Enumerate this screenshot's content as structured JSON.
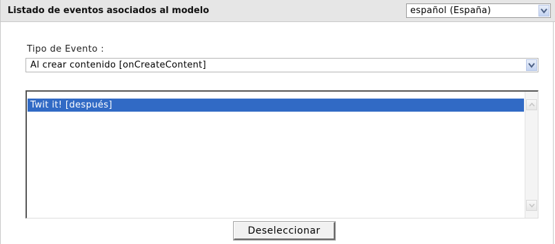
{
  "header": {
    "title": "Listado de eventos asociados al modelo",
    "language_select": {
      "value": "español (España)",
      "icon": "chevron-down-icon"
    }
  },
  "event_type": {
    "label": "Tipo de Evento :",
    "value": "Al crear contenido [onCreateContent]",
    "icon": "chevron-down-icon"
  },
  "event_list": {
    "items": [
      {
        "label": "Twit it! [después]",
        "selected": true
      }
    ],
    "selected_color": "#316ac5"
  },
  "actions": {
    "deselect_label": "Deseleccionar"
  }
}
